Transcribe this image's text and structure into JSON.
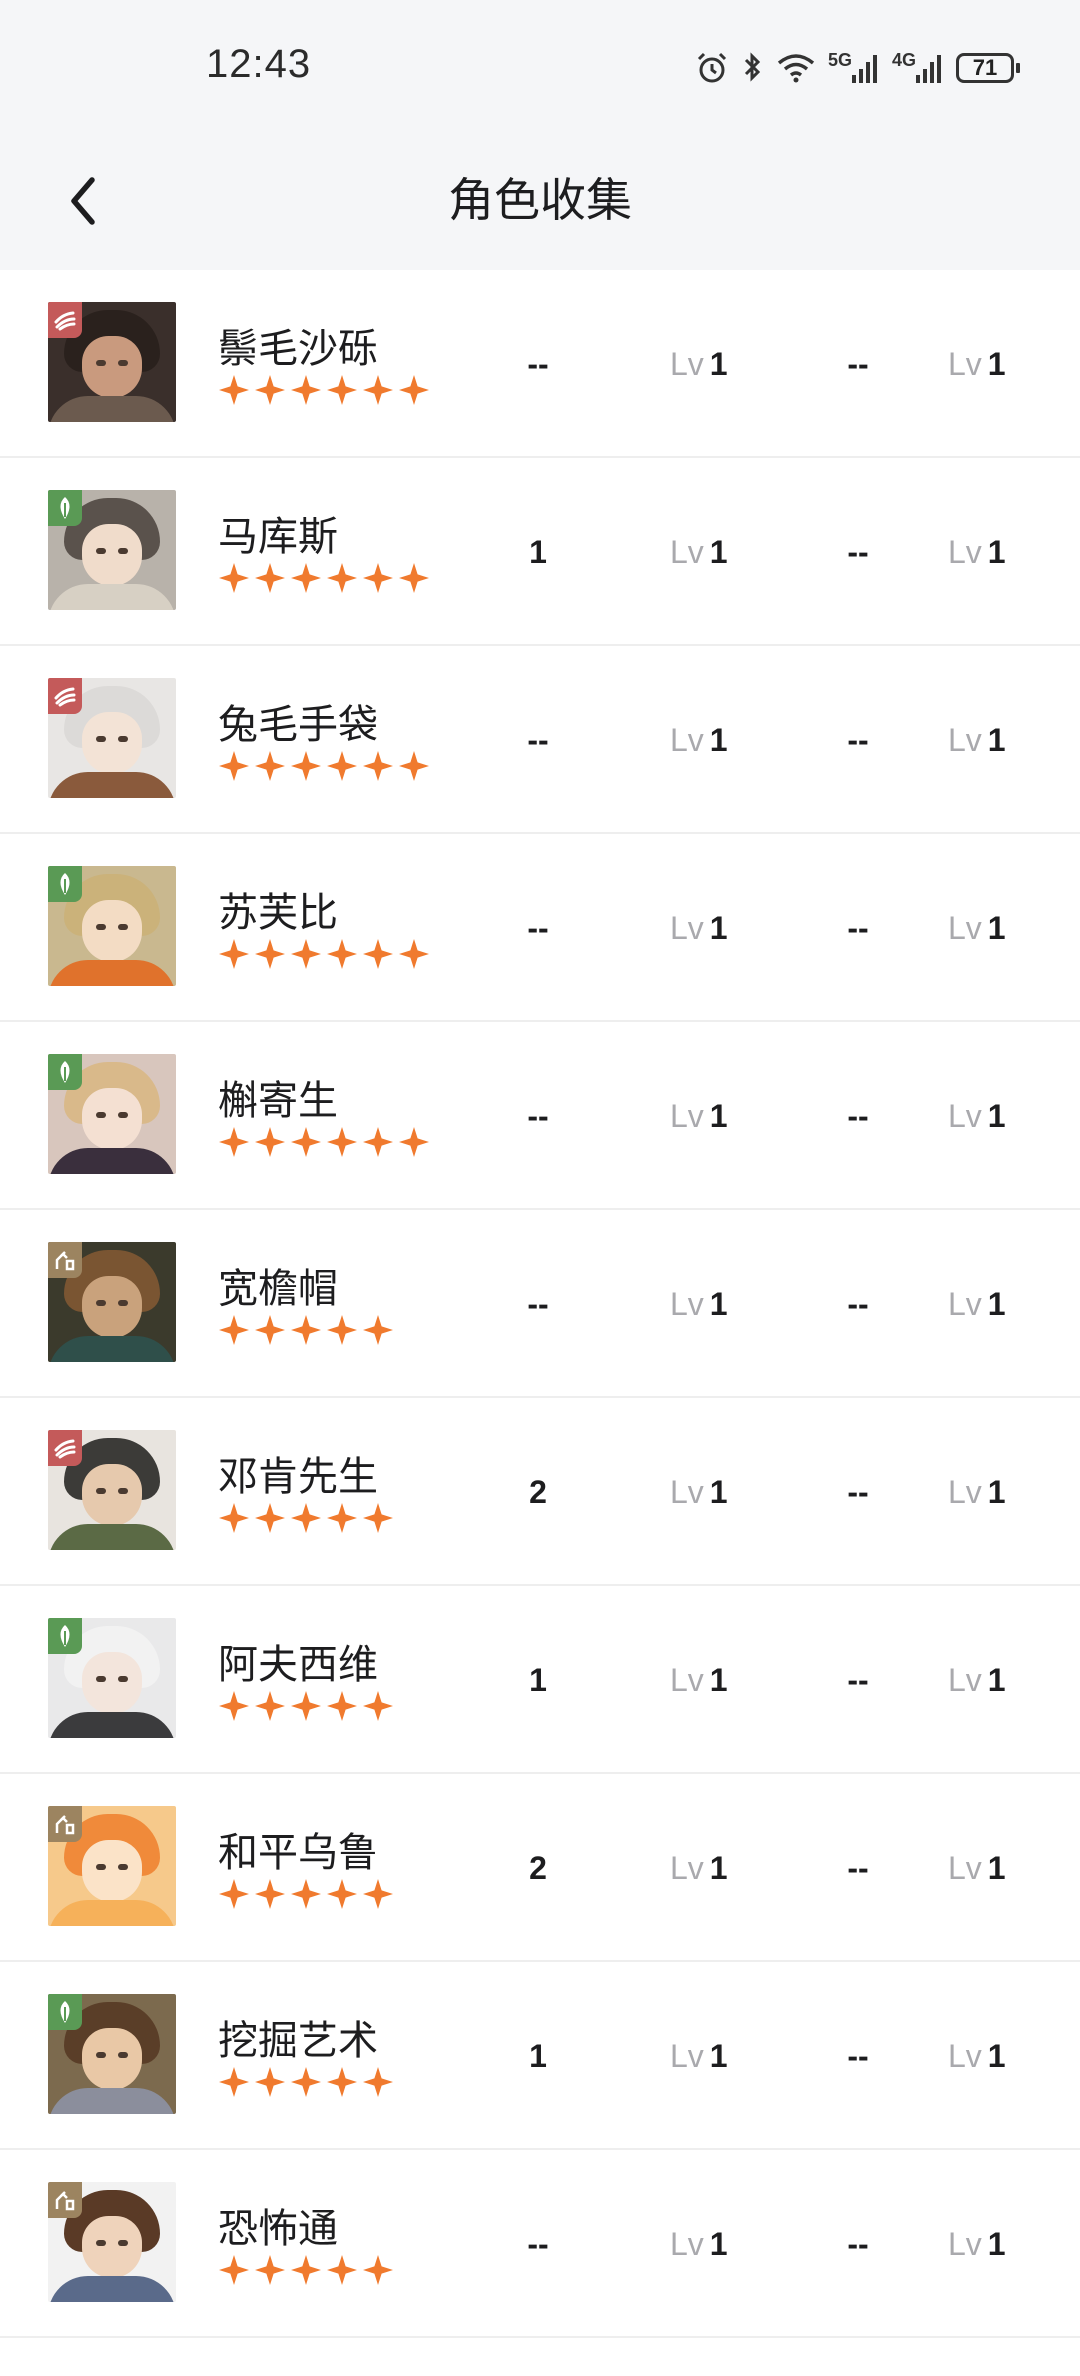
{
  "status_bar": {
    "time": "12:43",
    "signal_5g": "5G",
    "signal_4g": "4G",
    "battery": "71",
    "icons": [
      "alarm-icon",
      "bluetooth-icon",
      "wifi-icon",
      "signal-5g-icon",
      "signal-4g-icon",
      "battery-icon"
    ]
  },
  "header": {
    "title": "角色收集",
    "back_icon": "chevron-left-icon"
  },
  "colors": {
    "star": "#f07a2e",
    "badge_red": "#c45a5a",
    "badge_green": "#5a9a55",
    "badge_tan": "#9c8460",
    "text_primary": "#1d1d1f",
    "text_muted": "#a9a9ad",
    "header_bg": "#f5f6f8"
  },
  "characters": [
    {
      "name": "鬃毛沙砾",
      "stars": 6,
      "badge": "red",
      "col1": "--",
      "lv1_prefix": "Lv",
      "lv1": "1",
      "col2": "--",
      "lv2_prefix": "Lv",
      "lv2": "1",
      "bg": "#3a2f2b",
      "hair": "#2a211d",
      "clothes": "#6b5a4e",
      "skin": "#c99a7e"
    },
    {
      "name": "马库斯",
      "stars": 6,
      "badge": "green",
      "col1": "1",
      "lv1_prefix": "Lv",
      "lv1": "1",
      "col2": "--",
      "lv2_prefix": "Lv",
      "lv2": "1",
      "bg": "#b8b2aa",
      "hair": "#5a524c",
      "clothes": "#d7d0c4",
      "skin": "#f0dccb"
    },
    {
      "name": "兔毛手袋",
      "stars": 6,
      "badge": "red",
      "col1": "--",
      "lv1_prefix": "Lv",
      "lv1": "1",
      "col2": "--",
      "lv2_prefix": "Lv",
      "lv2": "1",
      "bg": "#e8e6e4",
      "hair": "#dcdad8",
      "clothes": "#8a5a3c",
      "skin": "#f3e3d6"
    },
    {
      "name": "苏芙比",
      "stars": 6,
      "badge": "green",
      "col1": "--",
      "lv1_prefix": "Lv",
      "lv1": "1",
      "col2": "--",
      "lv2_prefix": "Lv",
      "lv2": "1",
      "bg": "#c9b88f",
      "hair": "#cbb27a",
      "clothes": "#e0722c",
      "skin": "#f3dcc4"
    },
    {
      "name": "槲寄生",
      "stars": 6,
      "badge": "green",
      "col1": "--",
      "lv1_prefix": "Lv",
      "lv1": "1",
      "col2": "--",
      "lv2_prefix": "Lv",
      "lv2": "1",
      "bg": "#d8c6bd",
      "hair": "#d9b98a",
      "clothes": "#3a2f3d",
      "skin": "#f4e0d2"
    },
    {
      "name": "宽檐帽",
      "stars": 5,
      "badge": "tan",
      "col1": "--",
      "lv1_prefix": "Lv",
      "lv1": "1",
      "col2": "--",
      "lv2_prefix": "Lv",
      "lv2": "1",
      "bg": "#3b3a2c",
      "hair": "#7a5532",
      "clothes": "#2f4f4a",
      "skin": "#c9a27c"
    },
    {
      "name": "邓肯先生",
      "stars": 5,
      "badge": "red",
      "col1": "2",
      "lv1_prefix": "Lv",
      "lv1": "1",
      "col2": "--",
      "lv2_prefix": "Lv",
      "lv2": "1",
      "bg": "#e8e4df",
      "hair": "#3c3b38",
      "clothes": "#5b6a45",
      "skin": "#e6c9ad"
    },
    {
      "name": "阿夫西维",
      "stars": 5,
      "badge": "green",
      "col1": "1",
      "lv1_prefix": "Lv",
      "lv1": "1",
      "col2": "--",
      "lv2_prefix": "Lv",
      "lv2": "1",
      "bg": "#e9e9ea",
      "hair": "#f2f2f2",
      "clothes": "#3b3b3d",
      "skin": "#f3e5dc"
    },
    {
      "name": "和平乌鲁",
      "stars": 5,
      "badge": "tan",
      "col1": "2",
      "lv1_prefix": "Lv",
      "lv1": "1",
      "col2": "--",
      "lv2_prefix": "Lv",
      "lv2": "1",
      "bg": "#f6c98b",
      "hair": "#f08a3a",
      "clothes": "#f6b15a",
      "skin": "#fbe3c8"
    },
    {
      "name": "挖掘艺术",
      "stars": 5,
      "badge": "green",
      "col1": "1",
      "lv1_prefix": "Lv",
      "lv1": "1",
      "col2": "--",
      "lv2_prefix": "Lv",
      "lv2": "1",
      "bg": "#7c6a4e",
      "hair": "#5a3e28",
      "clothes": "#8b8e9c",
      "skin": "#e9c8a6"
    },
    {
      "name": "恐怖通",
      "stars": 5,
      "badge": "tan",
      "col1": "--",
      "lv1_prefix": "Lv",
      "lv1": "1",
      "col2": "--",
      "lv2_prefix": "Lv",
      "lv2": "1",
      "bg": "#f2f2f2",
      "hair": "#5a3a26",
      "clothes": "#5a6a8a",
      "skin": "#efd3bb"
    }
  ]
}
